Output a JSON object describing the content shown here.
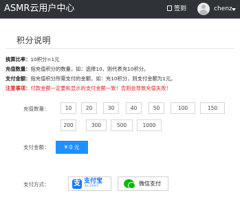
{
  "header": {
    "brand": "ASMR云用户中心",
    "signin_label": "签到",
    "username": "chenz"
  },
  "section": {
    "title": "积分说明"
  },
  "info": {
    "rate_label": "换算比率：",
    "rate_text": "10积分=1元",
    "qty_label": "充值数量：",
    "qty_text": "指充值积分的数量，如：选择10，则代表充10积分。",
    "pay_label": "支付金额：",
    "pay_text": "指充值积分所需支付的金额，如：充10积分，则支付金额为1元。",
    "warn_label": "注意事项：",
    "warn_text": "付款金额一定要和显示的支付金额一致！否则会导致充值失败！"
  },
  "recharge": {
    "label": "充值数量：",
    "amounts": [
      "10",
      "20",
      "30",
      "40",
      "50",
      "100",
      "150",
      "200",
      "300",
      "500",
      "1000"
    ]
  },
  "payment": {
    "label": "支付金额：",
    "amount_text": "¥ 0 元"
  },
  "methods": {
    "label": "支付方式：",
    "alipay_name": "支付宝",
    "alipay_sub": "ALIPAY",
    "wechat_name": "微信支付"
  },
  "colors": {
    "topbar": "#2f3237",
    "accent": "#1e90ff",
    "warning": "#e02020",
    "alipay": "#1677ff",
    "wechat": "#09bb07"
  },
  "icons": {
    "signin": "calendar-check-icon",
    "avatar": "user-avatar",
    "dropdown": "caret-down-icon",
    "alipay": "alipay-logo",
    "wechat": "wechat-pay-logo"
  }
}
